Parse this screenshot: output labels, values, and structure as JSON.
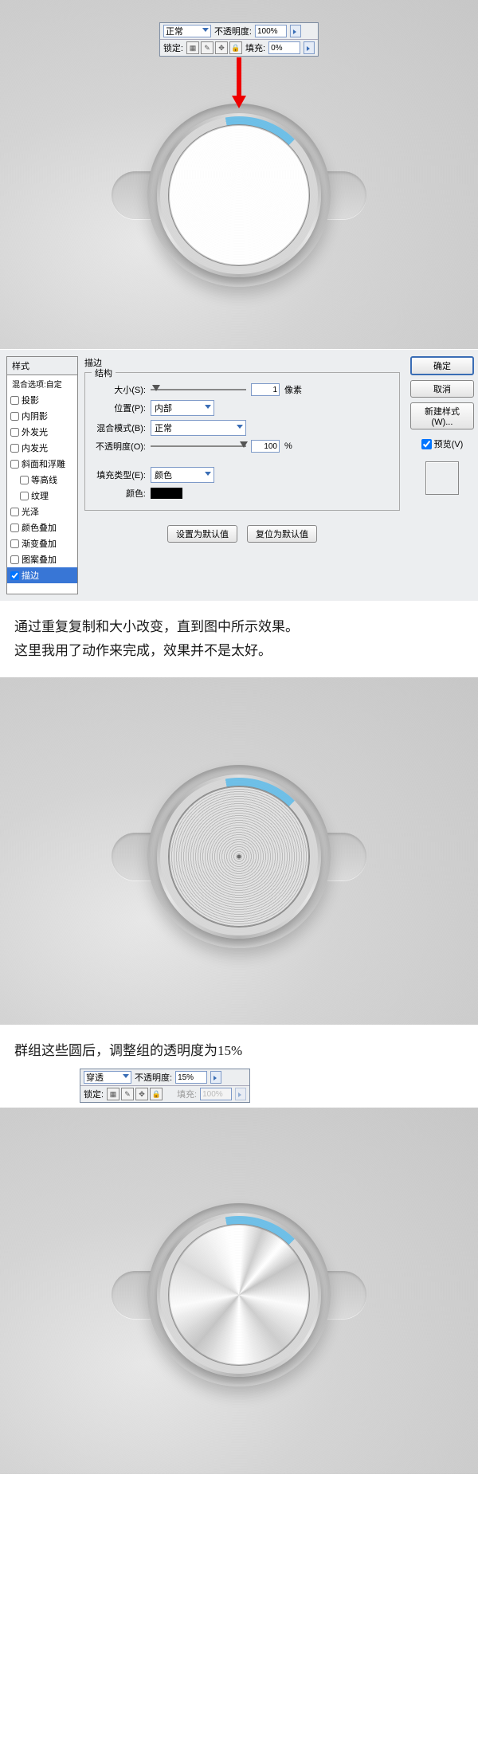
{
  "panel1": {
    "blend_label": "正常",
    "opacity_label": "不透明度:",
    "opacity_value": "100%",
    "lock_label": "锁定:",
    "fill_label": "填充:",
    "fill_value": "0%"
  },
  "dialog": {
    "left_header": "样式",
    "left_sub": "混合选项:自定",
    "items": [
      {
        "label": "投影",
        "checked": false
      },
      {
        "label": "内阴影",
        "checked": false
      },
      {
        "label": "外发光",
        "checked": false
      },
      {
        "label": "内发光",
        "checked": false
      },
      {
        "label": "斜面和浮雕",
        "checked": false
      },
      {
        "label": "等高线",
        "checked": false,
        "indent": true
      },
      {
        "label": "纹理",
        "checked": false,
        "indent": true
      },
      {
        "label": "光泽",
        "checked": false
      },
      {
        "label": "颜色叠加",
        "checked": false
      },
      {
        "label": "渐变叠加",
        "checked": false
      },
      {
        "label": "图案叠加",
        "checked": false
      },
      {
        "label": "描边",
        "checked": true,
        "active": true
      }
    ],
    "title": "描边",
    "struct_title": "结构",
    "size_label": "大小(S):",
    "size_value": "1",
    "size_unit": "像素",
    "position_label": "位置(P):",
    "position_value": "内部",
    "blend_label": "混合模式(B):",
    "blend_value": "正常",
    "opacity_label": "不透明度(O):",
    "opacity_value": "100",
    "opacity_unit": "%",
    "filltype_label": "填充类型(E):",
    "filltype_value": "颜色",
    "color_label": "颜色:",
    "set_default": "设置为默认值",
    "reset_default": "复位为默认值",
    "ok": "确定",
    "cancel": "取消",
    "new_style": "新建样式(W)...",
    "preview": "预览(V)"
  },
  "caption1_line1": "通过重复复制和大小改变，直到图中所示效果。",
  "caption1_line2": "这里我用了动作来完成，效果并不是太好。",
  "caption2": "群组这些圆后，调整组的透明度为15%",
  "panel2": {
    "blend_label": "穿透",
    "opacity_label": "不透明度:",
    "opacity_value": "15%",
    "lock_label": "锁定:",
    "fill_label": "填充:",
    "fill_value": "100%"
  }
}
